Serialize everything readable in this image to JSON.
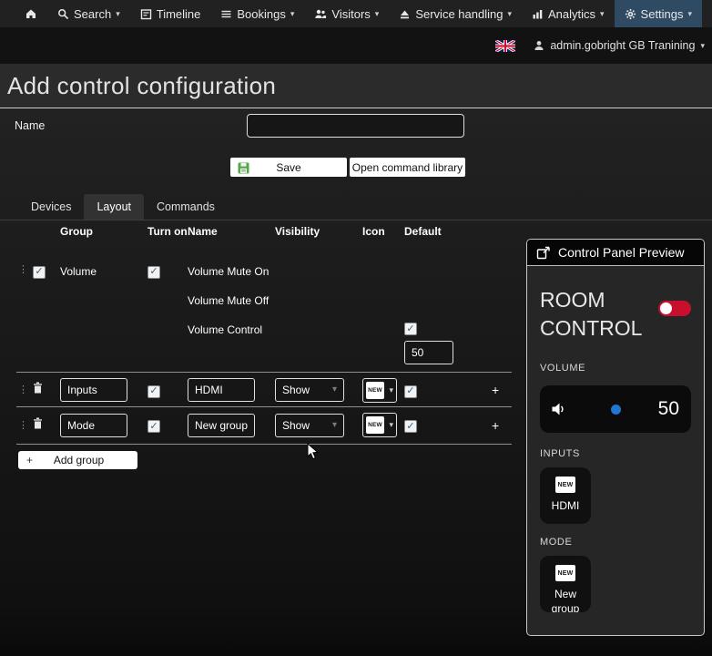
{
  "icons": {
    "plus": "+",
    "check": "✓",
    "caret": "▾",
    "drag": "⋮"
  },
  "nav": {
    "items": [
      {
        "label": "Search"
      },
      {
        "label": "Timeline"
      },
      {
        "label": "Bookings"
      },
      {
        "label": "Visitors"
      },
      {
        "label": "Service handling"
      },
      {
        "label": "Analytics"
      },
      {
        "label": "Settings"
      }
    ],
    "user": "admin.gobright GB Tranining"
  },
  "page": {
    "title": "Add control configuration"
  },
  "form": {
    "name_label": "Name",
    "name_value": "",
    "save_label": "Save",
    "open_library_label": "Open command library"
  },
  "tabs": [
    {
      "label": "Devices"
    },
    {
      "label": "Layout"
    },
    {
      "label": "Commands"
    }
  ],
  "table": {
    "headers": [
      "Group",
      "Turn on",
      "Name",
      "Visibility",
      "Icon",
      "Default"
    ],
    "volume_row": {
      "group": "Volume",
      "items": [
        "Volume Mute On",
        "Volume Mute Off",
        "Volume Control"
      ],
      "default_value": "50"
    },
    "rows": [
      {
        "group": "Inputs",
        "name": "HDMI",
        "visibility": "Show",
        "icon": "NEW"
      },
      {
        "group": "Mode",
        "name": "New group item",
        "visibility": "Show",
        "icon": "NEW"
      }
    ],
    "add_group_label": "Add group"
  },
  "preview": {
    "title": "Control Panel Preview",
    "room_title": "ROOM CONTROL",
    "volume_label": "VOLUME",
    "volume_value": "50",
    "inputs_label": "INPUTS",
    "input_button_label": "HDMI",
    "mode_label": "MODE",
    "mode_button_label": "New group",
    "icon_badge": "NEW"
  },
  "colors": {
    "accent_blue": "#2176d2",
    "toggle_red": "#c8102e",
    "save_green": "#57a64a",
    "active_nav": "#2e4b63"
  }
}
